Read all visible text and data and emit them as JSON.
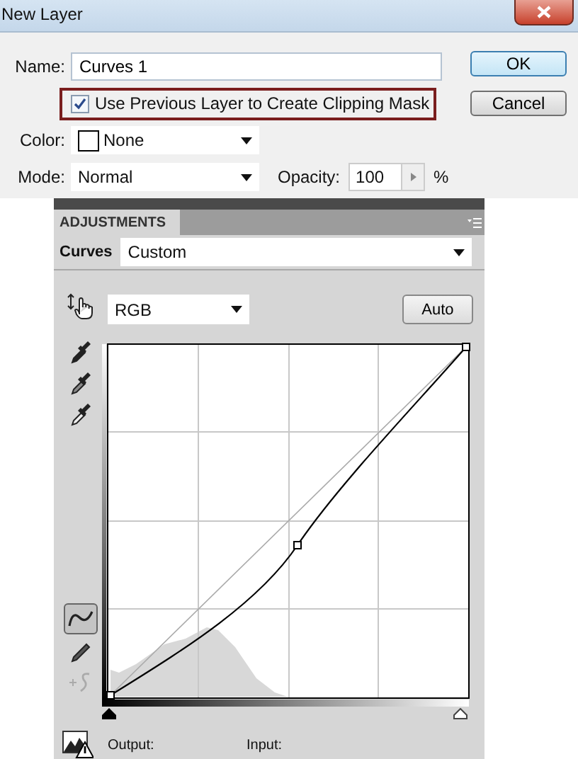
{
  "dialog": {
    "title": "New Layer",
    "name_label": "Name:",
    "name_value": "Curves 1",
    "clip_option": {
      "label": "Use Previous Layer to Create Clipping Mask",
      "checked": true
    },
    "color_label": "Color:",
    "color_value": "None",
    "mode_label": "Mode:",
    "mode_value": "Normal",
    "opacity_label": "Opacity:",
    "opacity_value": "100",
    "opacity_unit": "%",
    "buttons": [
      {
        "label": "OK",
        "kind": "default"
      },
      {
        "label": "Cancel",
        "kind": "normal"
      }
    ]
  },
  "panel": {
    "tab": "ADJUSTMENTS",
    "adjustment_label": "Curves",
    "preset": "Custom",
    "channel": "RGB",
    "auto_button": "Auto",
    "output_label": "Output:",
    "input_label": "Input:",
    "edit_modes": [
      {
        "kind": "points",
        "selected": true
      },
      {
        "kind": "pencil",
        "selected": false
      }
    ]
  }
}
